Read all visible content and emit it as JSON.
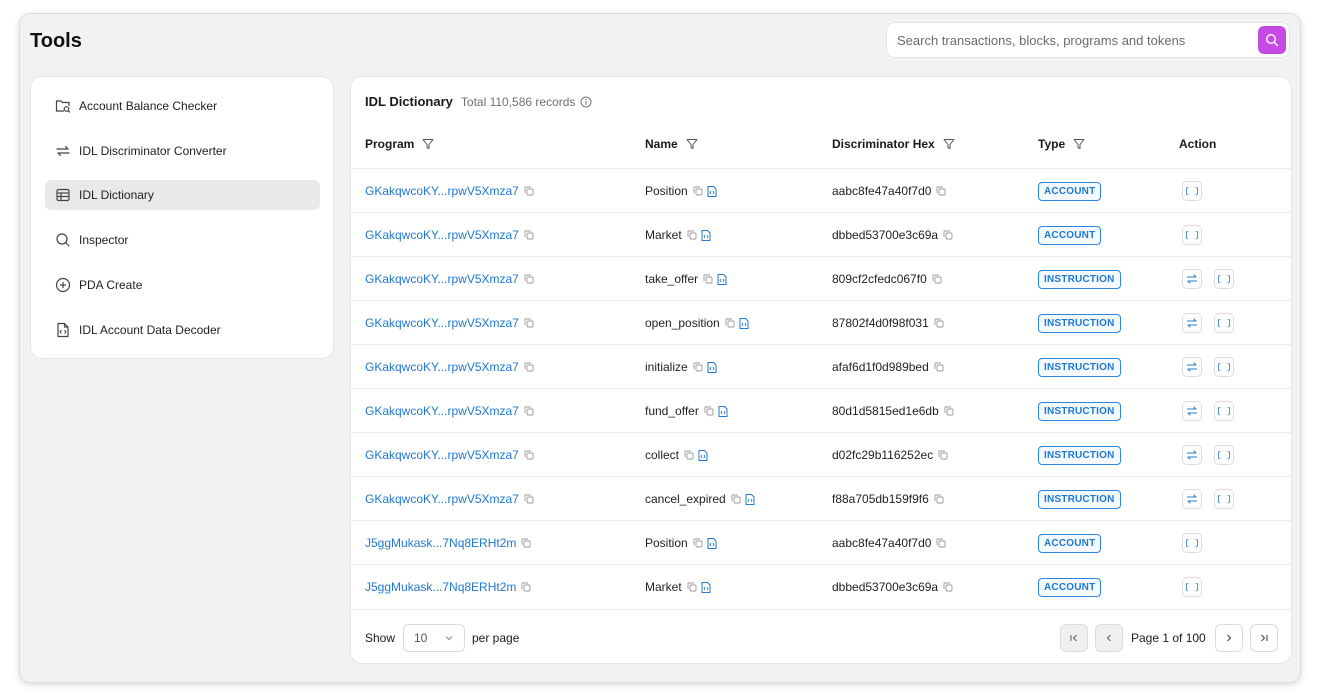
{
  "header": {
    "title": "Tools",
    "search_placeholder": "Search transactions, blocks, programs and tokens"
  },
  "sidebar": {
    "items": [
      {
        "label": "Account Balance Checker",
        "icon": "folder-search-icon",
        "active": false
      },
      {
        "label": "IDL Discriminator Converter",
        "icon": "swap-arrows-icon",
        "active": false
      },
      {
        "label": "IDL Dictionary",
        "icon": "table-icon",
        "active": true
      },
      {
        "label": "Inspector",
        "icon": "search-icon",
        "active": false
      },
      {
        "label": "PDA Create",
        "icon": "plus-circle-icon",
        "active": false
      },
      {
        "label": "IDL Account Data Decoder",
        "icon": "file-code-icon",
        "active": false
      }
    ]
  },
  "main": {
    "title": "IDL Dictionary",
    "subtitle": "Total 110,586 records",
    "columns": [
      "Program",
      "Name",
      "Discriminator Hex",
      "Type",
      "Action"
    ],
    "rows": [
      {
        "program": "GKakqwcoKY...rpwV5Xmza7",
        "name": "Position",
        "hex": "aabc8fe47a40f7d0",
        "type": "ACCOUNT"
      },
      {
        "program": "GKakqwcoKY...rpwV5Xmza7",
        "name": "Market",
        "hex": "dbbed53700e3c69a",
        "type": "ACCOUNT"
      },
      {
        "program": "GKakqwcoKY...rpwV5Xmza7",
        "name": "take_offer",
        "hex": "809cf2cfedc067f0",
        "type": "INSTRUCTION"
      },
      {
        "program": "GKakqwcoKY...rpwV5Xmza7",
        "name": "open_position",
        "hex": "87802f4d0f98f031",
        "type": "INSTRUCTION"
      },
      {
        "program": "GKakqwcoKY...rpwV5Xmza7",
        "name": "initialize",
        "hex": "afaf6d1f0d989bed",
        "type": "INSTRUCTION"
      },
      {
        "program": "GKakqwcoKY...rpwV5Xmza7",
        "name": "fund_offer",
        "hex": "80d1d5815ed1e6db",
        "type": "INSTRUCTION"
      },
      {
        "program": "GKakqwcoKY...rpwV5Xmza7",
        "name": "collect",
        "hex": "d02fc29b116252ec",
        "type": "INSTRUCTION"
      },
      {
        "program": "GKakqwcoKY...rpwV5Xmza7",
        "name": "cancel_expired",
        "hex": "f88a705db159f9f6",
        "type": "INSTRUCTION"
      },
      {
        "program": "J5ggMukask...7Nq8ERHt2m",
        "name": "Position",
        "hex": "aabc8fe47a40f7d0",
        "type": "ACCOUNT"
      },
      {
        "program": "J5ggMukask...7Nq8ERHt2m",
        "name": "Market",
        "hex": "dbbed53700e3c69a",
        "type": "ACCOUNT"
      }
    ]
  },
  "footer": {
    "show_label": "Show",
    "page_size": "10",
    "per_page_label": "per page",
    "page_text": "Page 1 of 100"
  },
  "colors": {
    "accent": "#c54be3",
    "link": "#1f78d1",
    "active_nav": "#e9e9e9"
  }
}
